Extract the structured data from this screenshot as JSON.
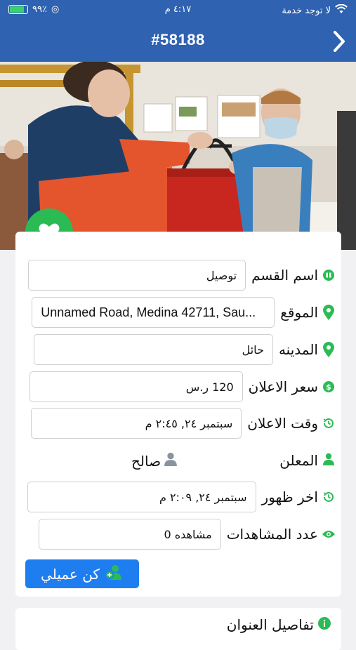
{
  "status": {
    "carrier": "لا توجد خدمة",
    "time": "٤:١٧ م",
    "battery": "٩٩٪"
  },
  "header": {
    "title": "#58188"
  },
  "fields": {
    "category": {
      "label": "اسم القسم",
      "value": "توصيل"
    },
    "location": {
      "label": "الموقع",
      "value": "Unnamed Road, Medina 42711, Sau..."
    },
    "city": {
      "label": "المدينه",
      "value": "حائل"
    },
    "price": {
      "label": "سعر الاعلان",
      "value": "120 ر.س"
    },
    "posted": {
      "label": "وقت الاعلان",
      "value": "سبتمبر ٢٤, ٢:٤٥ م"
    },
    "advertiser": {
      "label": "المعلن",
      "value": "صالح"
    },
    "last_seen": {
      "label": "اخر ظهور",
      "value": "سبتمبر ٢٤, ٢:٠٩ م"
    },
    "views": {
      "label": "عدد المشاهدات",
      "value": "مشاهده 0"
    }
  },
  "cta": {
    "label": "كن عميلي"
  },
  "section": {
    "address_details": "تفاصيل العنوان"
  },
  "colors": {
    "brand": "#2f62b0",
    "green": "#2bbb55",
    "button": "#1e7ef0"
  }
}
